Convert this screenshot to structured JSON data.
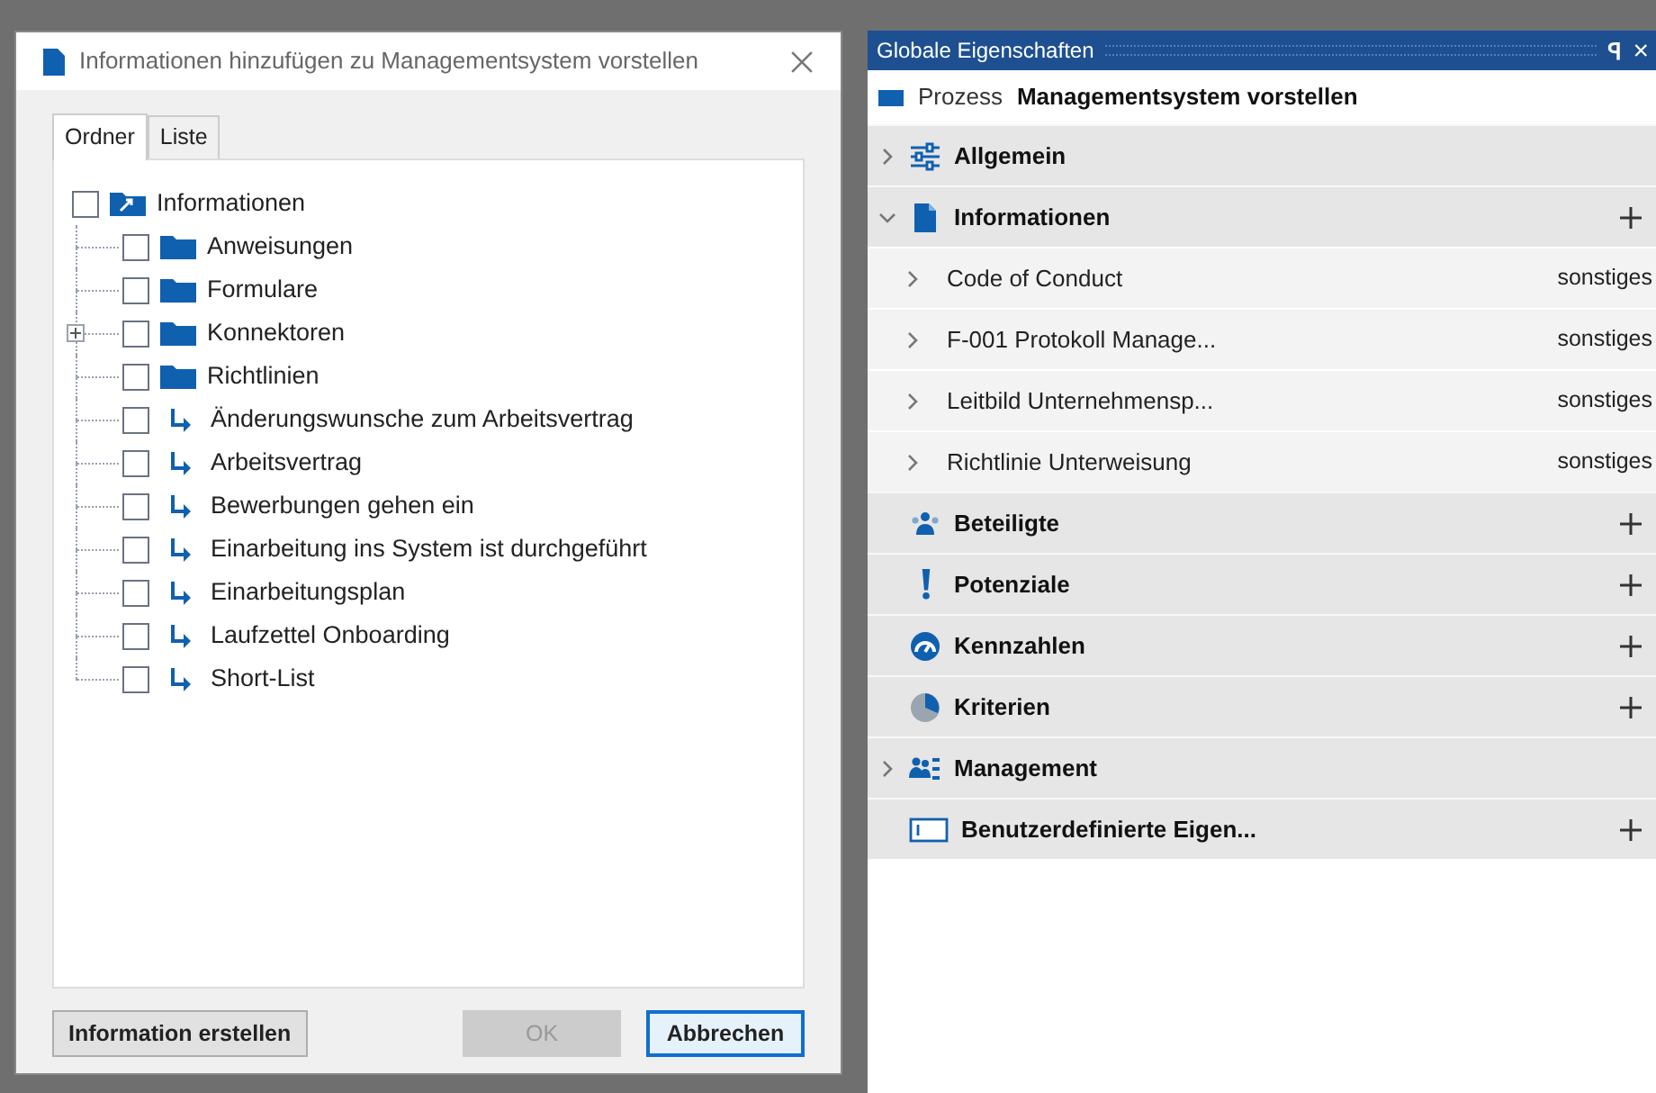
{
  "dialog": {
    "title": "Informationen hinzufügen zu Managementsystem vorstellen",
    "tabs": [
      {
        "label": "Ordner",
        "selected": true
      },
      {
        "label": "Liste",
        "selected": false
      }
    ],
    "tree": {
      "label": "Informationen",
      "kind": "root",
      "checked": false,
      "children": [
        {
          "label": "Anweisungen",
          "kind": "folder",
          "checked": false,
          "collapsed": false
        },
        {
          "label": "Formulare",
          "kind": "folder",
          "checked": false,
          "collapsed": false
        },
        {
          "label": "Konnektoren",
          "kind": "folder",
          "checked": false,
          "collapsed": true
        },
        {
          "label": "Richtlinien",
          "kind": "folder",
          "checked": false,
          "collapsed": false
        },
        {
          "label": "Änderungswunsche zum Arbeitsvertrag",
          "kind": "link",
          "checked": false,
          "collapsed": false
        },
        {
          "label": "Arbeitsvertrag",
          "kind": "link",
          "checked": false,
          "collapsed": false
        },
        {
          "label": "Bewerbungen gehen ein",
          "kind": "link",
          "checked": false,
          "collapsed": false
        },
        {
          "label": "Einarbeitung ins System ist durchgeführt",
          "kind": "link",
          "checked": false,
          "collapsed": false
        },
        {
          "label": "Einarbeitungsplan",
          "kind": "link",
          "checked": false,
          "collapsed": false
        },
        {
          "label": "Laufzettel Onboarding",
          "kind": "link",
          "checked": false,
          "collapsed": false
        },
        {
          "label": "Short-List",
          "kind": "link",
          "checked": false,
          "collapsed": false
        }
      ]
    },
    "buttons": [
      {
        "label": "Information erstellen",
        "disabled": false,
        "focused": false
      },
      {
        "label": "OK",
        "disabled": true,
        "focused": false
      },
      {
        "label": "Abbrechen",
        "disabled": false,
        "focused": true
      }
    ]
  },
  "panel": {
    "title": "Globale Eigenschaften",
    "pin": "ꟼ",
    "close": "×",
    "subject": {
      "type": "Prozess",
      "name": "Managementsystem vorstellen"
    },
    "sections": [
      {
        "label": "Allgemein",
        "kind": "settings",
        "expanded": false,
        "add": false
      },
      {
        "label": "Informationen",
        "kind": "document",
        "expanded": true,
        "add": true,
        "items": [
          {
            "name": "Code of Conduct",
            "type": "sonstiges"
          },
          {
            "name": "F-001 Protokoll Manage...",
            "type": "sonstiges"
          },
          {
            "name": "Leitbild Unternehmensp...",
            "type": "sonstiges"
          },
          {
            "name": "Richtlinie Unterweisung",
            "type": "sonstiges"
          }
        ]
      },
      {
        "label": "Beteiligte",
        "kind": "people",
        "add": true
      },
      {
        "label": "Potenziale",
        "kind": "exclamation",
        "add": true
      },
      {
        "label": "Kennzahlen",
        "kind": "gauge",
        "add": true
      },
      {
        "label": "Kriterien",
        "kind": "pie",
        "add": true
      },
      {
        "label": "Management",
        "kind": "org",
        "expanded": false,
        "add": false
      },
      {
        "label": "Benutzerdefinierte Eigen...",
        "kind": "custom",
        "add": true
      }
    ]
  }
}
